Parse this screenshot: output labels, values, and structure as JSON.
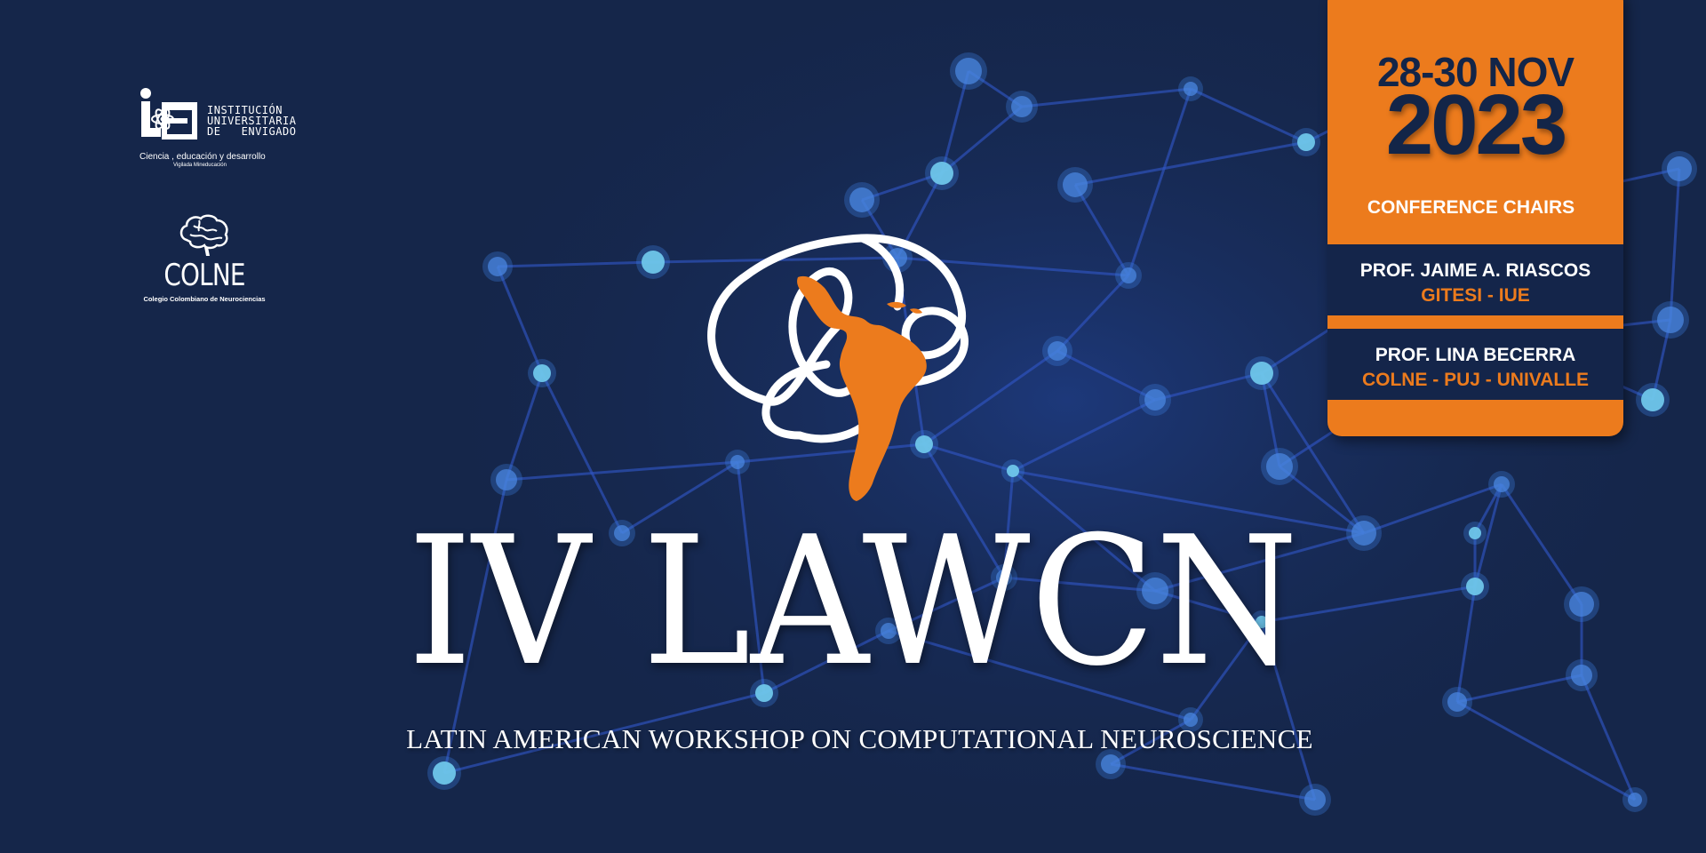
{
  "logos": {
    "iue": {
      "name_lines": [
        "INSTITUCIÓN",
        "UNIVERSITARIA",
        "DE   ENVIGADO"
      ],
      "tagline": "Ciencia , educación y desarrollo",
      "subline": "Vigilada Mineducación",
      "icon": "iue-atom-logo-icon"
    },
    "colne": {
      "name": "COLNE",
      "subline": "Colegio Colombiano de Neurociencias",
      "icon": "brain-icon"
    }
  },
  "emblem": {
    "icon": "brain-knot-latin-america-icon",
    "colors": {
      "knot": "#ffffff",
      "continent": "#ec7b1d"
    }
  },
  "event": {
    "title": "IV LAWCN",
    "subtitle": "LATIN AMERICAN WORKSHOP ON COMPUTATIONAL NEUROSCIENCE"
  },
  "panel": {
    "dates": "28-30 NOV",
    "year": "2023",
    "chairs_heading": "CONFERENCE CHAIRS",
    "chairs": [
      {
        "name": "PROF. JAIME A. RIASCOS",
        "affiliation": "GITESI - IUE"
      },
      {
        "name": "PROF. LINA BECERRA",
        "affiliation": "COLNE - PUJ - UNIVALLE"
      }
    ]
  },
  "colors": {
    "background": "#15264a",
    "accent_orange": "#ec7b1d",
    "panel_navy": "#14254a",
    "network_line": "#3158c8",
    "network_node": "#6fc6ea"
  }
}
